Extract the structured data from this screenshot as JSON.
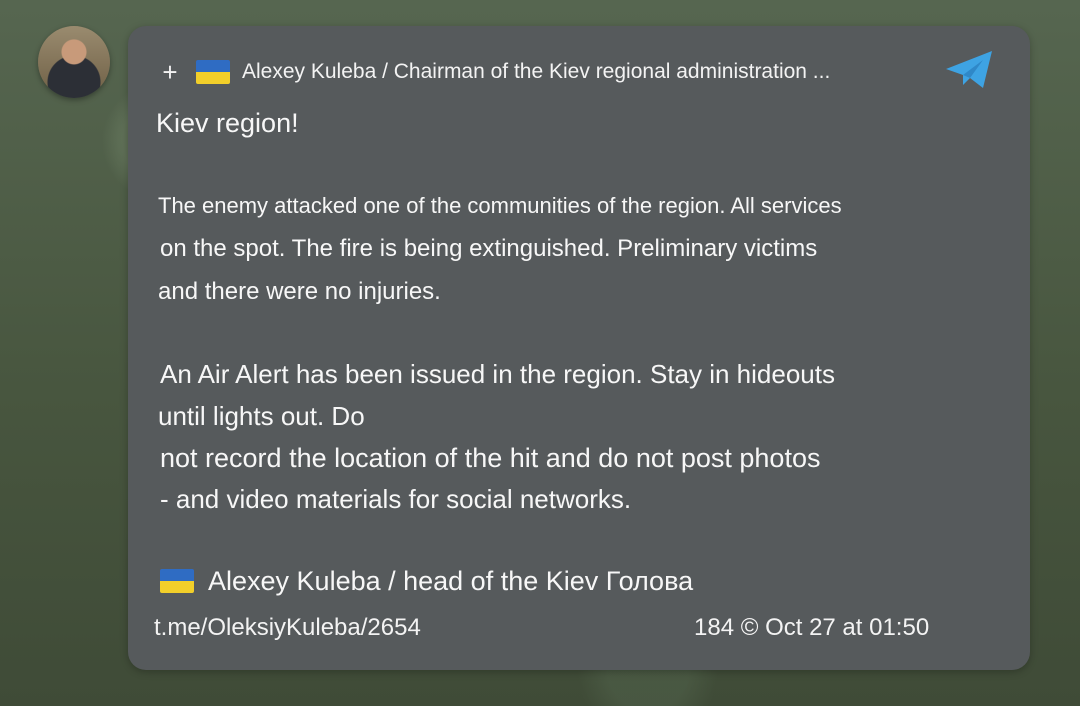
{
  "post": {
    "header_prefix": "+",
    "header_title": "Alexey Kuleba / Chairman of the Kiev regional administration ...",
    "body_lines": [
      "Kiev region!",
      "The enemy attacked one of the communities of the region. All services",
      "on the spot. The fire is being extinguished. Preliminary victims",
      "and there were no injuries.",
      "An Air Alert has been issued in the region. Stay in hideouts",
      "until lights out. Do",
      "not record the location of the hit and do not post photos",
      "- and video materials for social networks."
    ],
    "signature": "Alexey Kuleba / head of the Kiev Голова",
    "link": "t.me/OleksiyKuleba/2654",
    "meta": "184 © Oct 27 at 01:50"
  },
  "icons": {
    "add": "plus-icon",
    "flag": "ukraine-flag-icon",
    "telegram": "telegram-icon",
    "avatar": "avatar"
  },
  "colors": {
    "bubble": "#565a5c",
    "flag_blue": "#2f6cc3",
    "flag_yellow": "#f2cf2a",
    "text": "#f7f7f7"
  }
}
